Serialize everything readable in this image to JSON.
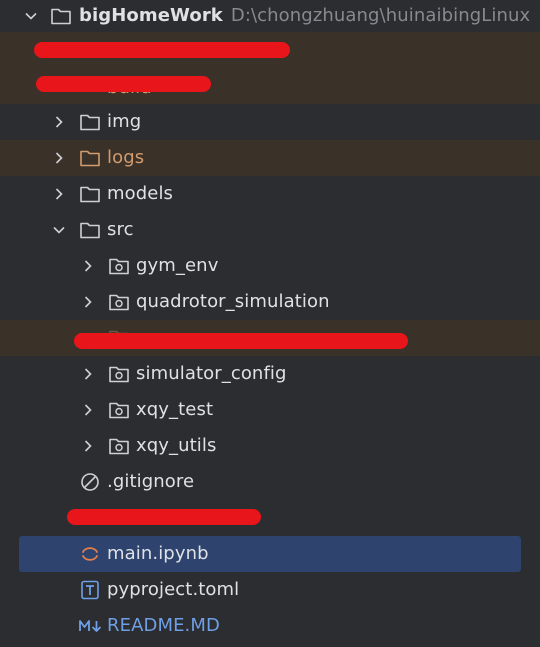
{
  "project": {
    "name": "bigHomeWork",
    "path": "D:\\chongzhuang\\huinaibingLinux"
  },
  "items": [
    {
      "label": "img"
    },
    {
      "label": "logs"
    },
    {
      "label": "models"
    },
    {
      "label": "src"
    },
    {
      "label": "gym_env"
    },
    {
      "label": "quadrotor_simulation"
    },
    {
      "label": "simulator_config"
    },
    {
      "label": "xqy_test"
    },
    {
      "label": "xqy_utils"
    },
    {
      "label": ".gitignore"
    },
    {
      "label": "main.ipynb"
    },
    {
      "label": "pyproject.toml"
    },
    {
      "label": "README.MD"
    }
  ],
  "partial_labels": {
    "build": "build"
  },
  "icons": {
    "folder": "folder-icon",
    "package": "package-folder-icon",
    "ignore": "gitignore-icon",
    "notebook": "notebook-icon",
    "toml": "toml-file-icon",
    "markdown": "markdown-icon"
  },
  "colors": {
    "background": "#2b2d30",
    "text": "#dfe1e5",
    "ignored_row": "#3a3129",
    "ignored_text": "#d29c6e",
    "selected_row": "#2e436e",
    "markdown_text": "#6f9fe6",
    "redaction": "#e8151b"
  }
}
